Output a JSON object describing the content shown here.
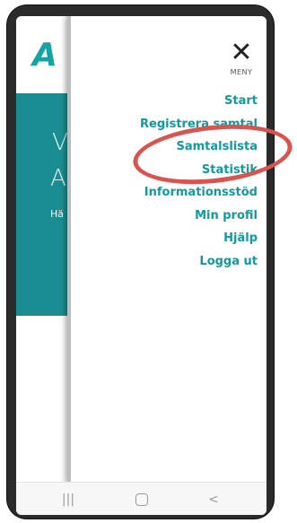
{
  "hero": {
    "line1": "V",
    "line2": "A",
    "line3": "Hä"
  },
  "logo": {
    "text": "A",
    "color": "#16a3a6"
  },
  "menu": {
    "close_label": "MENY",
    "close_icon": "close-icon",
    "items": [
      {
        "label": "Start"
      },
      {
        "label": "Registrera samtal"
      },
      {
        "label": "Samtalslista"
      },
      {
        "label": "Statistik"
      },
      {
        "label": "Informationsstöd"
      },
      {
        "label": "Min profil"
      },
      {
        "label": "Hjälp"
      },
      {
        "label": "Logga ut"
      }
    ],
    "item_color": "#139a9c"
  },
  "annotation": {
    "color": "#d9534f",
    "highlighted_item": "Statistik"
  },
  "nav_bar": {
    "recent_glyph": "|||",
    "back_glyph": "<"
  }
}
